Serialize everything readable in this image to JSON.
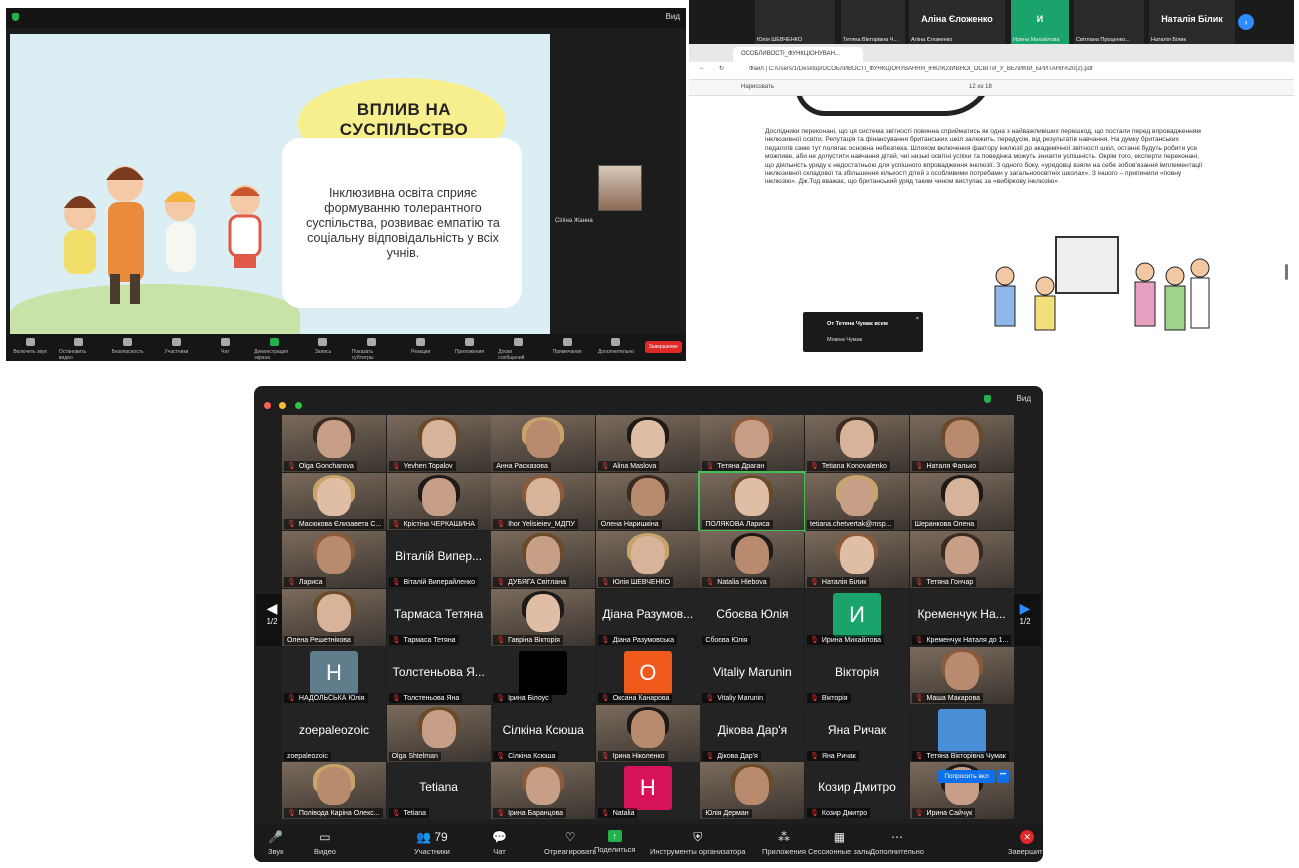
{
  "shot1": {
    "view_label": "Вид",
    "slide": {
      "title": "ВПЛИВ НА СУСПІЛЬСТВО",
      "body": "Інклюзивна освіта сприяє формуванню толерантного суспільства, розвиває емпатію та соціальну відповідальність у всіх учнів."
    },
    "self_name": "Сіліна Жанна",
    "toolbar": [
      {
        "label": "Включить звук"
      },
      {
        "label": "Остановить видео"
      },
      {
        "label": "Безопасность"
      },
      {
        "label": "Участники"
      },
      {
        "label": "Чат"
      },
      {
        "label": "Демонстрация экрана"
      },
      {
        "label": "Запись"
      },
      {
        "label": "Показать субтитры"
      },
      {
        "label": "Реакции"
      },
      {
        "label": "Приложения"
      },
      {
        "label": "Доски сообщений"
      },
      {
        "label": "Примечания"
      },
      {
        "label": "Дополнительно"
      }
    ],
    "end_label": "Завершение"
  },
  "shot2": {
    "strip": [
      {
        "name": "Юлія ШЕВЧЕНКО"
      },
      {
        "name": "Тетяна Вікторівна Ч..."
      },
      {
        "name": "Аліна Єложенко",
        "big": "Аліна Єложенко"
      },
      {
        "name": "Ирина Михайлова",
        "big": "И"
      },
      {
        "name": "Світлана Проценко..."
      },
      {
        "name": "Наталія Білик",
        "big": "Наталія Білик"
      }
    ],
    "tab_title": "ОСОБЛИВОСТІ_ФУНКЦІОНУВАН...",
    "address": "Файл | C:/Users/1/Desktop/ОСОБЛИВОСТІ_ФУНКЦІОНУВАННЯ_ІНКЛЮЗИВНОЇ_ОСВІТИ_У_ВЕЛИКІЙ_БРИТАНІЇ%20(2).pdf",
    "draw_label": "Нарисовать",
    "page_indicator": "12  из 18",
    "pdf_text": "Дослідники переконані, що ця система звітності повинна сприйматись як одна з найважливіших перешкод, що постали перед впровадженням інклюзивної освіти. Репутація та фінансування британських шкіл залежить, передусім, від результатів навчання. На думку британських педагогів саме тут полягає основна небезпека. Шляхом включення фактору інклюзії до академічної звітності шкіл, останні будуть робити усе можливе, аби не допустити навчання дітей, чиї низькі освітні успіхи та поведінка можуть знизити успішність. Окрім того, експерти переконані, що діяльність уряду є недостатньою для успішного впровадження інклюзії. З одного боку, «урядовці взяли на себе зобов'язання імплементації інклюзивної складової та збільшення кількості дітей з особливими потребами у загальноосвітніх школах». З іншого – припинили «повну інклюзію». Дж.Тод вважає, що британський уряд таким чином виступає за «вибіркову інклюзію»",
    "toast": {
      "from": "От Тетяна Чумак всем",
      "message": "Можна Чумак"
    }
  },
  "shot3": {
    "view_label": "Вид",
    "page_left": "1/2",
    "page_right": "1/2",
    "tiles": [
      {
        "name": "Olga Goncharova",
        "kind": "video"
      },
      {
        "name": "Yevhen Topalov",
        "kind": "video"
      },
      {
        "name": "Анна Расказова",
        "kind": "video",
        "muted": false
      },
      {
        "name": "Alina Maslova",
        "kind": "video"
      },
      {
        "name": "Тетяна Драган",
        "kind": "video"
      },
      {
        "name": "Tetiana Konovalenko",
        "kind": "video"
      },
      {
        "name": "Наталя Фалько",
        "kind": "video"
      },
      {
        "name": "Масюкова Єлизавета С...",
        "kind": "video"
      },
      {
        "name": "Крістіна ЧЕРКАШИНА",
        "kind": "video"
      },
      {
        "name": "Ihor Yelisieiev_МДПУ",
        "kind": "video"
      },
      {
        "name": "Олена Наришкіна",
        "kind": "video",
        "muted": false
      },
      {
        "name": "ПОЛЯКОВА Лариса",
        "kind": "video",
        "highlight": true,
        "muted": false
      },
      {
        "name": "tetiana.chetvertak@msp...",
        "kind": "video",
        "muted": false
      },
      {
        "name": "Шеранкова Олена",
        "kind": "video",
        "muted": false
      },
      {
        "name": "Лариса",
        "kind": "video"
      },
      {
        "name": "Віталій Виперайленко",
        "kind": "text",
        "big": "Віталій Випер..."
      },
      {
        "name": "ДУБЯГА Світлана",
        "kind": "video"
      },
      {
        "name": "Юлія ШЕВЧЕНКО",
        "kind": "video"
      },
      {
        "name": "Natalia Hlebova",
        "kind": "video"
      },
      {
        "name": "Наталія Білик",
        "kind": "video"
      },
      {
        "name": "Тетяна Гончар",
        "kind": "video"
      },
      {
        "name": "Олена Решетнікова",
        "kind": "video",
        "muted": false
      },
      {
        "name": "Тармаса Тетяна",
        "kind": "text",
        "big": "Тармаса Тетяна"
      },
      {
        "name": "Гавріна Вікторія",
        "kind": "video"
      },
      {
        "name": "Діана Разумовська",
        "kind": "text",
        "big": "Діана Разумов..."
      },
      {
        "name": "Сбоєва Юлія",
        "kind": "text",
        "big": "Сбоєва Юлія",
        "muted": false
      },
      {
        "name": "Ирина Михайлова",
        "kind": "avatar",
        "letter": "И",
        "color": "#1aa36a"
      },
      {
        "name": "Кременчук Наталя до 1...",
        "kind": "text",
        "big": "Кременчук На..."
      },
      {
        "name": "НАДОЛЬСЬКА Юлія",
        "kind": "avatar",
        "letter": "Н",
        "color": "#607d8b"
      },
      {
        "name": "Толстеньова Яна",
        "kind": "text",
        "big": "Толстеньова Я..."
      },
      {
        "name": "Ірина Білоус",
        "kind": "avatar",
        "letter": "",
        "color": "#000000"
      },
      {
        "name": "Оксана Канарова",
        "kind": "avatar",
        "letter": "О",
        "color": "#f05a1c"
      },
      {
        "name": "Vitaliy Marunin",
        "kind": "text",
        "big": "Vitaliy Marunin"
      },
      {
        "name": "Вікторія",
        "kind": "text",
        "big": "Вікторія"
      },
      {
        "name": "Маша Макарова",
        "kind": "video"
      },
      {
        "name": "zoepaleozoic",
        "kind": "text",
        "big": "zoepaleozoic",
        "muted": false
      },
      {
        "name": "Olga Shtelman",
        "kind": "video",
        "muted": false
      },
      {
        "name": "Сілкіна Ксюша",
        "kind": "text",
        "big": "Сілкіна Ксюша"
      },
      {
        "name": "Ірина Ніколенко",
        "kind": "video"
      },
      {
        "name": "Дікова Дар'я",
        "kind": "text",
        "big": "Дікова Дар'я"
      },
      {
        "name": "Яна Ричак",
        "kind": "text",
        "big": "Яна Ричак"
      },
      {
        "name": "Тетяна Вікторівна Чумак",
        "kind": "avatar",
        "letter": "",
        "color": "#4a90d9"
      },
      {
        "name": "Поліводa Каріна Олекс...",
        "kind": "video"
      },
      {
        "name": "Tetiana",
        "kind": "text",
        "big": "Tetiana"
      },
      {
        "name": "Ірина Баранцова",
        "kind": "video"
      },
      {
        "name": "Natalia",
        "kind": "avatar",
        "letter": "Н",
        "color": "#d6135a"
      },
      {
        "name": "Юлія Дерман",
        "kind": "video",
        "muted": false
      },
      {
        "name": "Козир Дмитро",
        "kind": "text",
        "big": "Козир Дмитро"
      },
      {
        "name": "Ирина Сайчук",
        "kind": "video"
      }
    ],
    "request_label": "Попросить вкл",
    "request_more": "•••",
    "toolbar": [
      {
        "label": "Звук",
        "icon": "🎤",
        "cls": "mic"
      },
      {
        "label": "Видео",
        "icon": "▭"
      },
      {
        "label": "Участники",
        "icon": "👥 79"
      },
      {
        "label": "Чат",
        "icon": "💬"
      },
      {
        "label": "Отреагировать",
        "icon": "♡"
      },
      {
        "label": "Поделиться",
        "icon": "↑",
        "cls": "g"
      },
      {
        "label": "Инструменты организатора",
        "icon": "⛨"
      },
      {
        "label": "Приложения",
        "icon": "⁂"
      },
      {
        "label": "Сессионные залы",
        "icon": "▦"
      },
      {
        "label": "Дополнительно",
        "icon": "⋯"
      },
      {
        "label": "Завершить",
        "icon": "✕",
        "cls": "r"
      }
    ]
  }
}
